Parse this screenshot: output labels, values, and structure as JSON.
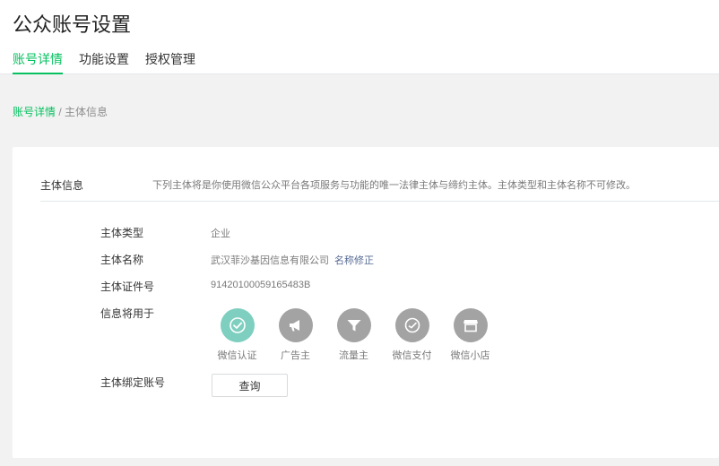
{
  "page": {
    "title": "公众账号设置"
  },
  "tabs": [
    {
      "label": "账号详情",
      "active": true
    },
    {
      "label": "功能设置",
      "active": false
    },
    {
      "label": "授权管理",
      "active": false
    }
  ],
  "breadcrumb": {
    "link": "账号详情",
    "separator": " / ",
    "current": "主体信息"
  },
  "section": {
    "title": "主体信息",
    "description": "下列主体将是你使用微信公众平台各项服务与功能的唯一法律主体与缔约主体。主体类型和主体名称不可修改。"
  },
  "fields": {
    "type": {
      "label": "主体类型",
      "value": "企业"
    },
    "name": {
      "label": "主体名称",
      "value": "武汉菲沙基因信息有限公司",
      "action": "名称修正"
    },
    "cert": {
      "label": "主体证件号",
      "value": "91420100059165483B"
    },
    "uses": {
      "label": "信息将用于",
      "items": [
        {
          "label": "微信认证",
          "icon": "check-icon",
          "active": true
        },
        {
          "label": "广告主",
          "icon": "megaphone-icon",
          "active": false
        },
        {
          "label": "流量主",
          "icon": "funnel-icon",
          "active": false
        },
        {
          "label": "微信支付",
          "icon": "pay-icon",
          "active": false
        },
        {
          "label": "微信小店",
          "icon": "store-icon",
          "active": false
        }
      ]
    },
    "bound": {
      "label": "主体绑定账号",
      "button": "查询"
    }
  },
  "colors": {
    "accent": "#07c160",
    "link": "#576b95",
    "active_icon": "#7ecfc0",
    "inactive_icon": "#a3a3a3"
  }
}
